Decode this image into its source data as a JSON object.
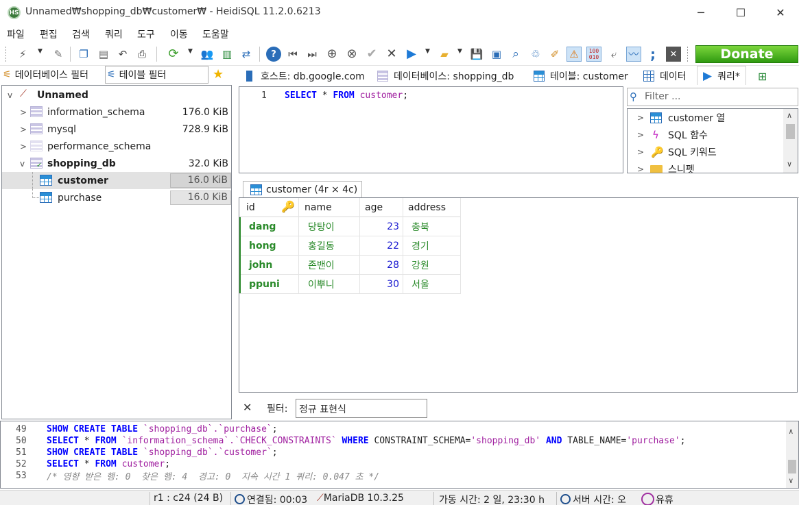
{
  "window": {
    "title": "Unnamed₩shopping_db₩customer₩ - HeidiSQL 11.2.0.6213",
    "app_icon_text": "HS",
    "minimize": "─",
    "maximize": "☐",
    "close": "✕"
  },
  "menu": [
    "파일",
    "편집",
    "검색",
    "쿼리",
    "도구",
    "이동",
    "도움말"
  ],
  "toolbar": {
    "donate_label": "Donate",
    "accent_color": "#3aa613"
  },
  "left_panel": {
    "db_filter_placeholder": "데이터베이스 필터",
    "table_filter_placeholder": "테이블 필터",
    "tree": {
      "root": "Unnamed",
      "databases": [
        {
          "name": "information_schema",
          "size": "176.0 KiB"
        },
        {
          "name": "mysql",
          "size": "728.9 KiB"
        },
        {
          "name": "performance_schema",
          "size": ""
        },
        {
          "name": "shopping_db",
          "size": "32.0 KiB"
        }
      ],
      "tables": [
        {
          "name": "customer",
          "size": "16.0 KiB"
        },
        {
          "name": "purchase",
          "size": "16.0 KiB"
        }
      ]
    }
  },
  "tabs": [
    {
      "label": "호스트: db.google.com"
    },
    {
      "label": "데이터베이스: shopping_db"
    },
    {
      "label": "테이블: customer"
    },
    {
      "label": "데이터"
    },
    {
      "label": "쿼리*"
    }
  ],
  "editor": {
    "line_number": "1",
    "kw1": "SELECT",
    "star": "*",
    "kw2": "FROM",
    "table": "customer",
    "end": ";"
  },
  "helper": {
    "filter_placeholder": "Filter ...",
    "items": [
      "customer 열",
      "SQL 함수",
      "SQL 키워드",
      "스니펫"
    ]
  },
  "result": {
    "tab_label": "customer (4r × 4c)",
    "columns": [
      "id",
      "name",
      "age",
      "address"
    ],
    "rows": [
      [
        "dang",
        "당탕이",
        "23",
        "충북"
      ],
      [
        "hong",
        "홍길동",
        "22",
        "경기"
      ],
      [
        "john",
        "존밴이",
        "28",
        "강원"
      ],
      [
        "ppuni",
        "이뿌니",
        "30",
        "서울"
      ]
    ]
  },
  "filter_bar": {
    "close": "✕",
    "label": "필터:",
    "placeholder": "정규 표현식"
  },
  "log": [
    {
      "n": "49",
      "parts": [
        [
          "kw",
          "SHOW CREATE TABLE "
        ],
        [
          "str",
          "`shopping_db`.`purchase`"
        ],
        [
          "p",
          ";"
        ]
      ]
    },
    {
      "n": "50",
      "parts": [
        [
          "kw",
          "SELECT "
        ],
        [
          "p",
          "* "
        ],
        [
          "kw",
          "FROM "
        ],
        [
          "str",
          "`information_schema`.`CHECK_CONSTRAINTS` "
        ],
        [
          "kw",
          "WHERE "
        ],
        [
          "p",
          "CONSTRAINT_SCHEMA="
        ],
        [
          "str",
          "'shopping_db' "
        ],
        [
          "kw",
          "AND "
        ],
        [
          "p",
          "TABLE_NAME="
        ],
        [
          "str",
          "'purchase'"
        ],
        [
          "p",
          ";"
        ]
      ]
    },
    {
      "n": "51",
      "parts": [
        [
          "kw",
          "SHOW CREATE TABLE "
        ],
        [
          "str",
          "`shopping_db`.`customer`"
        ],
        [
          "p",
          ";"
        ]
      ]
    },
    {
      "n": "52",
      "parts": [
        [
          "kw",
          "SELECT "
        ],
        [
          "p",
          "* "
        ],
        [
          "kw",
          "FROM "
        ],
        [
          "str",
          "customer"
        ],
        [
          "p",
          ";"
        ]
      ]
    },
    {
      "n": "53",
      "parts": [
        [
          "cmt",
          "/* 영향 받은 행: 0  찾은 행: 4  경고: 0  지속 시간 1 쿼리: 0.047 초 */"
        ]
      ]
    }
  ],
  "status": {
    "cursor": "r1 : c24 (24 B)",
    "connected": "연결됨: 00:03",
    "server": "MariaDB 10.3.25",
    "uptime": "가동 시간: 2 일, 23:30 h",
    "server_time": "서버 시간: 오",
    "idle": "유휴"
  }
}
